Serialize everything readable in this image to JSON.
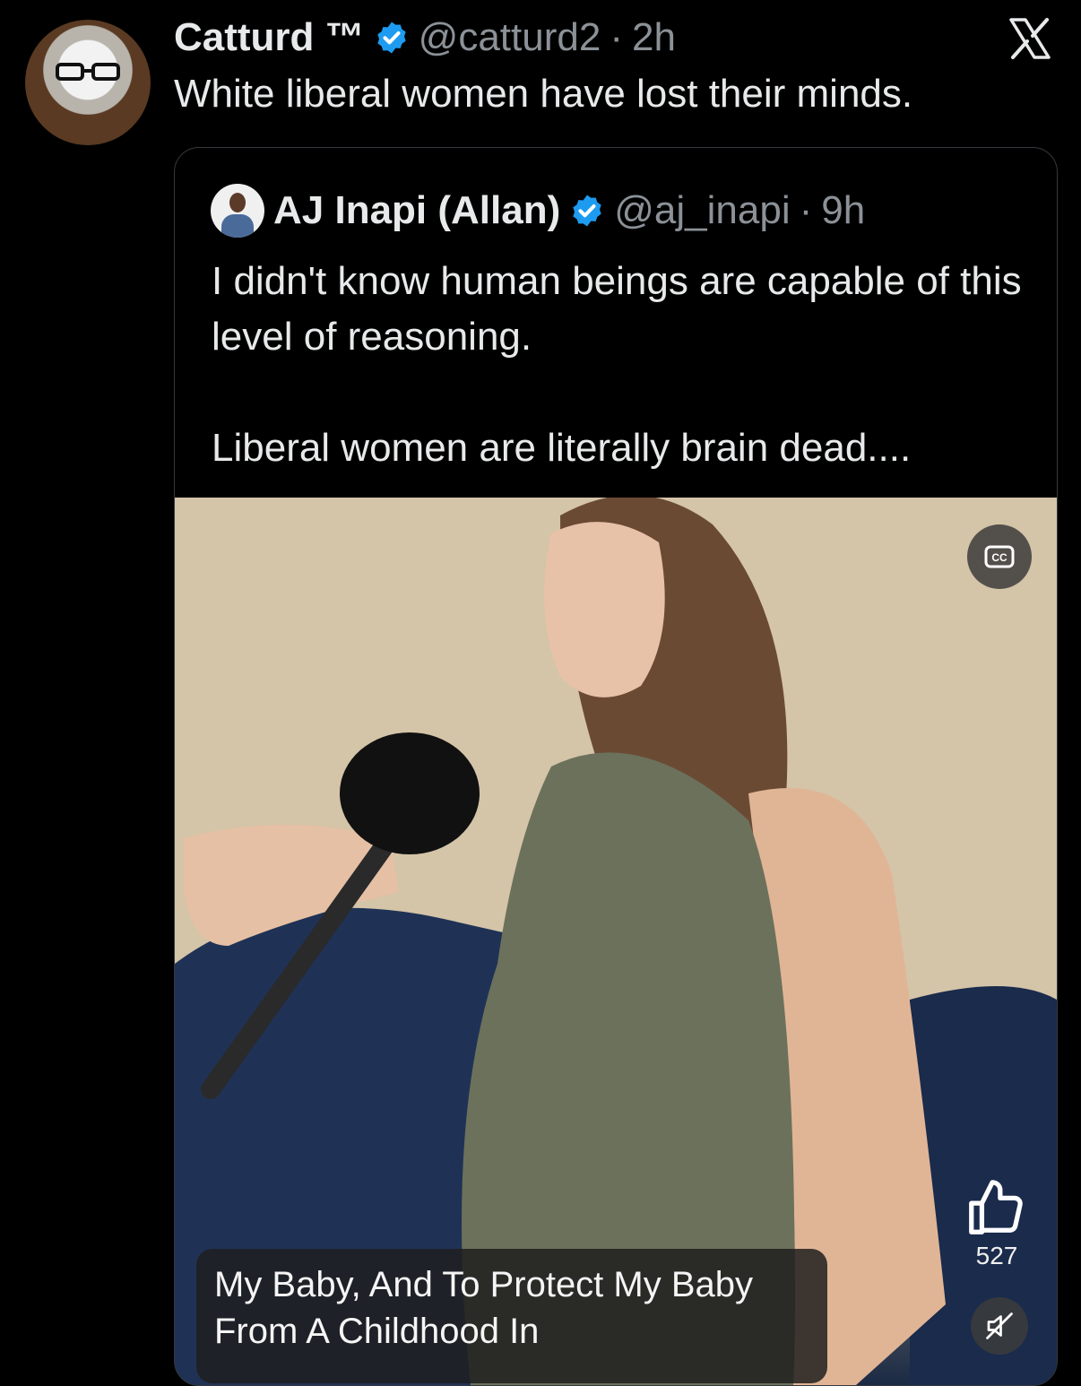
{
  "tweet": {
    "author_name": "Catturd ™",
    "handle": "@catturd2",
    "separator": "·",
    "time": "2h",
    "text": "White liberal women have lost their minds."
  },
  "quoted_tweet": {
    "author_name": "AJ Inapi (Allan)",
    "handle": "@aj_inapi",
    "separator": "·",
    "time": "9h",
    "text_line1": "I didn't know human beings are capable of this level of reasoning.",
    "text_line2": "Liberal women are literally brain dead...."
  },
  "video": {
    "cc_label": "CC",
    "caption": "My Baby, And To Protect My Baby From A Childhood In",
    "like_count": "527"
  },
  "colors": {
    "background": "#000000",
    "text": "#e7e9ea",
    "secondary_text": "#8b9197",
    "verified_blue": "#1d9bf0",
    "border": "#36393e"
  },
  "icons": [
    "x-logo-icon",
    "verified-badge-icon",
    "closed-captions-icon",
    "thumbs-up-icon",
    "muted-speaker-icon"
  ]
}
